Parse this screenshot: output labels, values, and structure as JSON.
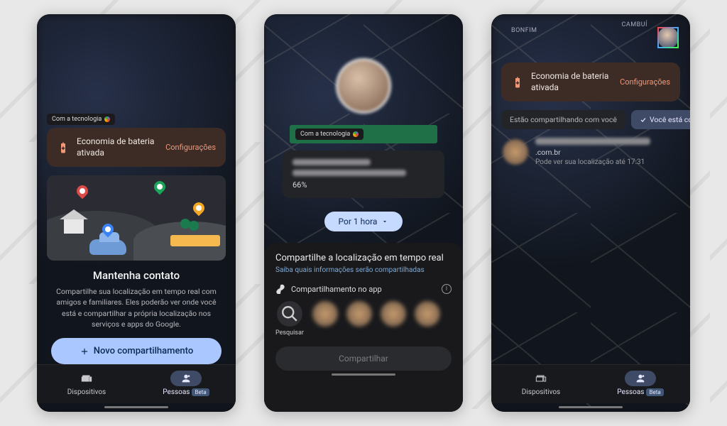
{
  "tech_chip": "Com a tecnologia",
  "battery_banner": {
    "title": "Economia de bateria ativada",
    "link": "Configurações"
  },
  "screen1": {
    "card_title": "Mantenha contato",
    "card_desc": "Compartilhe sua localização em tempo real com amigos e familiares. Eles poderão ver onde você está e compartilhar a própria localização nos serviços e apps do Google.",
    "new_share_btn": "Novo compartilhamento"
  },
  "nav": {
    "devices": "Dispositivos",
    "people": "Pessoas",
    "beta": "Beta"
  },
  "screen2": {
    "battery_pct": "66%",
    "duration": "Por 1 hora",
    "sheet_title": "Compartilhe a localização em tempo real",
    "sheet_sub": "Saiba quais informações serão compartilhadas",
    "app_share_label": "Compartilhamento no app",
    "search_label": "Pesquisar",
    "share_btn": "Compartilhar"
  },
  "screen3": {
    "map_labels": {
      "bonfim": "BONFIM",
      "cambui": "CAMBUÍ"
    },
    "tab_inactive": "Estão compartilhando com você",
    "tab_active": "Você está co",
    "person_sub1": ".com.br",
    "person_sub2": "Pode ver sua localização até 17:31"
  }
}
